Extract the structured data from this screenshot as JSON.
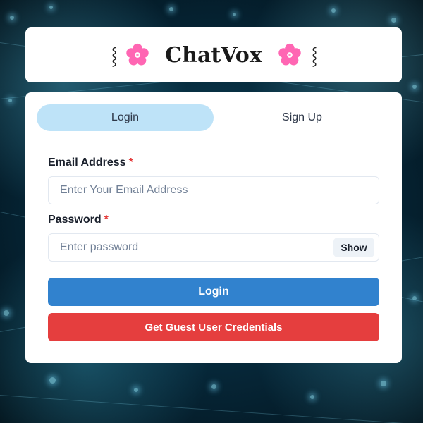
{
  "header": {
    "app_title": "ChatVox",
    "decoration_left": "⸾",
    "decoration_right": "⸾",
    "flower_icon": "cherry-blossom-icon"
  },
  "tabs": [
    {
      "label": "Login",
      "active": true
    },
    {
      "label": "Sign Up",
      "active": false
    }
  ],
  "form": {
    "email": {
      "label": "Email Address",
      "required_marker": "*",
      "placeholder": "Enter Your Email Address",
      "value": ""
    },
    "password": {
      "label": "Password",
      "required_marker": "*",
      "placeholder": "Enter password",
      "value": "",
      "toggle_label": "Show"
    },
    "login_button": "Login",
    "guest_button": "Get Guest User Credentials"
  },
  "colors": {
    "active_tab": "#bee3f8",
    "login_button": "#3182ce",
    "guest_button": "#e53e3e",
    "required": "#e53e3e",
    "flower": "#ff66b3"
  }
}
